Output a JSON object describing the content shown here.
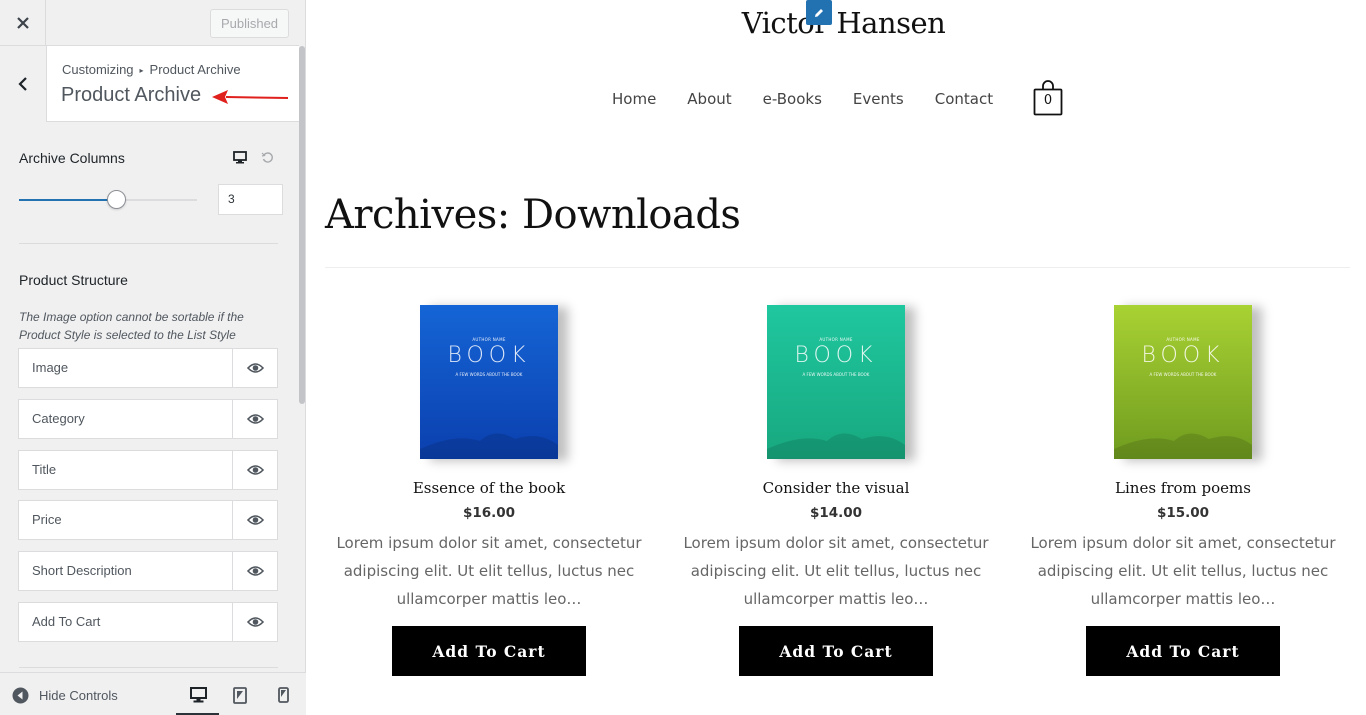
{
  "header": {
    "close_label": "×",
    "published_label": "Published"
  },
  "section": {
    "breadcrumb_root": "Customizing",
    "breadcrumb_current": "Product Archive",
    "title": "Product Archive"
  },
  "archive_columns": {
    "label": "Archive Columns",
    "value": "3",
    "slider_fraction": 0.55
  },
  "product_structure": {
    "label": "Product Structure",
    "note": "The Image option cannot be sortable if the Product Style is selected to the List Style",
    "items": [
      {
        "label": "Image"
      },
      {
        "label": "Category"
      },
      {
        "label": "Title"
      },
      {
        "label": "Price"
      },
      {
        "label": "Short Description"
      },
      {
        "label": "Add To Cart"
      }
    ]
  },
  "footer": {
    "hide_controls_label": "Hide Controls",
    "active_device": "desktop"
  },
  "site": {
    "title": "Victor Hansen",
    "nav": [
      "Home",
      "About",
      "e-Books",
      "Events",
      "Contact"
    ],
    "cart_count": "0",
    "archive_title": "Archives: Downloads"
  },
  "products": [
    {
      "name": "Essence of the book",
      "price": "$16.00",
      "desc": "Lorem ipsum dolor sit amet, consectetur adipiscing elit. Ut elit tellus, luctus nec ullamcorper mattis leo…",
      "button": "Add To Cart",
      "cover_word": "BOOK",
      "cover_author": "AUTHOR NAME",
      "cover_sub": "A FEW WORDS ABOUT THE BOOK",
      "color_top": "#1565d6",
      "color_bottom": "#0b3fae"
    },
    {
      "name": "Consider the visual",
      "price": "$14.00",
      "desc": "Lorem ipsum dolor sit amet, consectetur adipiscing elit. Ut elit tellus, luctus nec ullamcorper mattis leo…",
      "button": "Add To Cart",
      "cover_word": "BOOK",
      "cover_author": "AUTHOR NAME",
      "cover_sub": "A FEW WORDS ABOUT THE BOOK",
      "color_top": "#1fc79f",
      "color_bottom": "#18a87f"
    },
    {
      "name": "Lines from poems",
      "price": "$15.00",
      "desc": "Lorem ipsum dolor sit amet, consectetur adipiscing elit. Ut elit tellus, luctus nec ullamcorper mattis leo…",
      "button": "Add To Cart",
      "cover_word": "BOOK",
      "cover_author": "AUTHOR NAME",
      "cover_sub": "A FEW WORDS ABOUT THE BOOK",
      "color_top": "#a9d233",
      "color_bottom": "#6f9b1f"
    }
  ],
  "colors": {
    "accent": "#2271b1",
    "annotation_arrow": "#e0201c"
  }
}
